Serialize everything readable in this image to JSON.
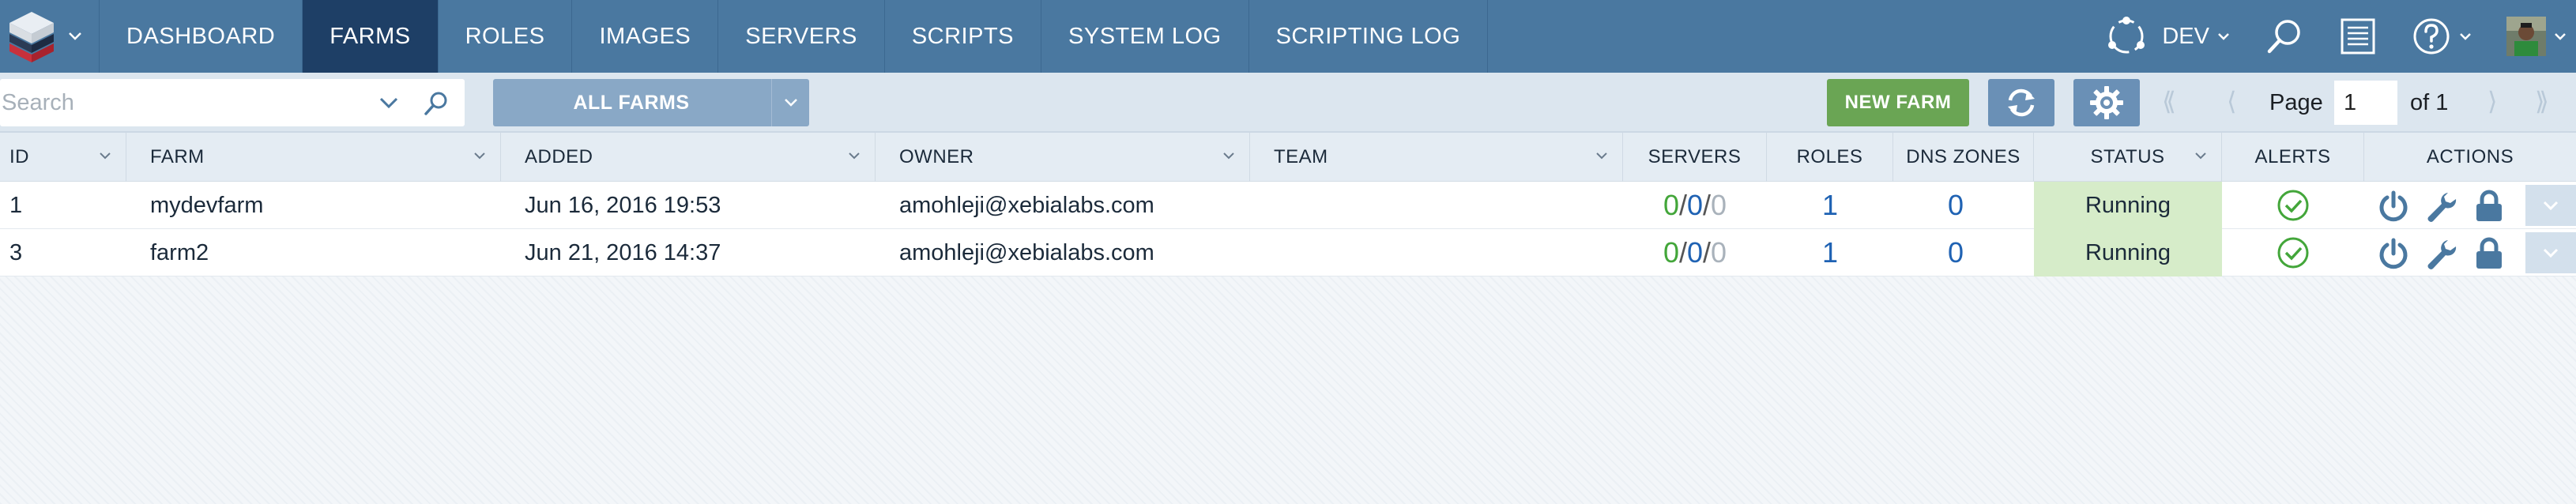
{
  "nav": {
    "items": [
      {
        "label": "DASHBOARD",
        "active": false
      },
      {
        "label": "FARMS",
        "active": true
      },
      {
        "label": "ROLES",
        "active": false
      },
      {
        "label": "IMAGES",
        "active": false
      },
      {
        "label": "SERVERS",
        "active": false
      },
      {
        "label": "SCRIPTS",
        "active": false
      },
      {
        "label": "SYSTEM LOG",
        "active": false
      },
      {
        "label": "SCRIPTING LOG",
        "active": false
      }
    ],
    "environment": "DEV",
    "icons": [
      "env-icon",
      "search-icon",
      "log-icon",
      "help-icon",
      "avatar"
    ],
    "colors": {
      "bar": "#4a78a0",
      "active": "#1e3f66"
    }
  },
  "toolbar": {
    "search_placeholder": "Search",
    "farm_filter": "ALL FARMS",
    "new_farm": "NEW FARM",
    "page_label": "Page",
    "page_value": "1",
    "page_of": "of 1",
    "colors": {
      "new_farm": "#6aa554",
      "filter": "#89a8c6"
    }
  },
  "table": {
    "headers": {
      "id": "ID",
      "farm": "FARM",
      "added": "ADDED",
      "owner": "OWNER",
      "team": "TEAM",
      "servers": "SERVERS",
      "roles": "ROLES",
      "dns": "DNS ZONES",
      "status": "STATUS",
      "alerts": "ALERTS",
      "actions": "ACTIONS"
    },
    "rows": [
      {
        "id": "1",
        "farm": "mydevfarm",
        "added": "Jun 16, 2016 19:53",
        "owner": "amohleji@xebialabs.com",
        "team": "",
        "servers_running": "0",
        "servers_pending": "0",
        "servers_stopped": "0",
        "sep": "/",
        "roles": "1",
        "dns": "0",
        "status": "Running"
      },
      {
        "id": "3",
        "farm": "farm2",
        "added": "Jun 21, 2016 14:37",
        "owner": "amohleji@xebialabs.com",
        "team": "",
        "servers_running": "0",
        "servers_pending": "0",
        "servers_stopped": "0",
        "sep": "/",
        "roles": "1",
        "dns": "0",
        "status": "Running"
      }
    ],
    "status_color": "#d6ecc9"
  }
}
